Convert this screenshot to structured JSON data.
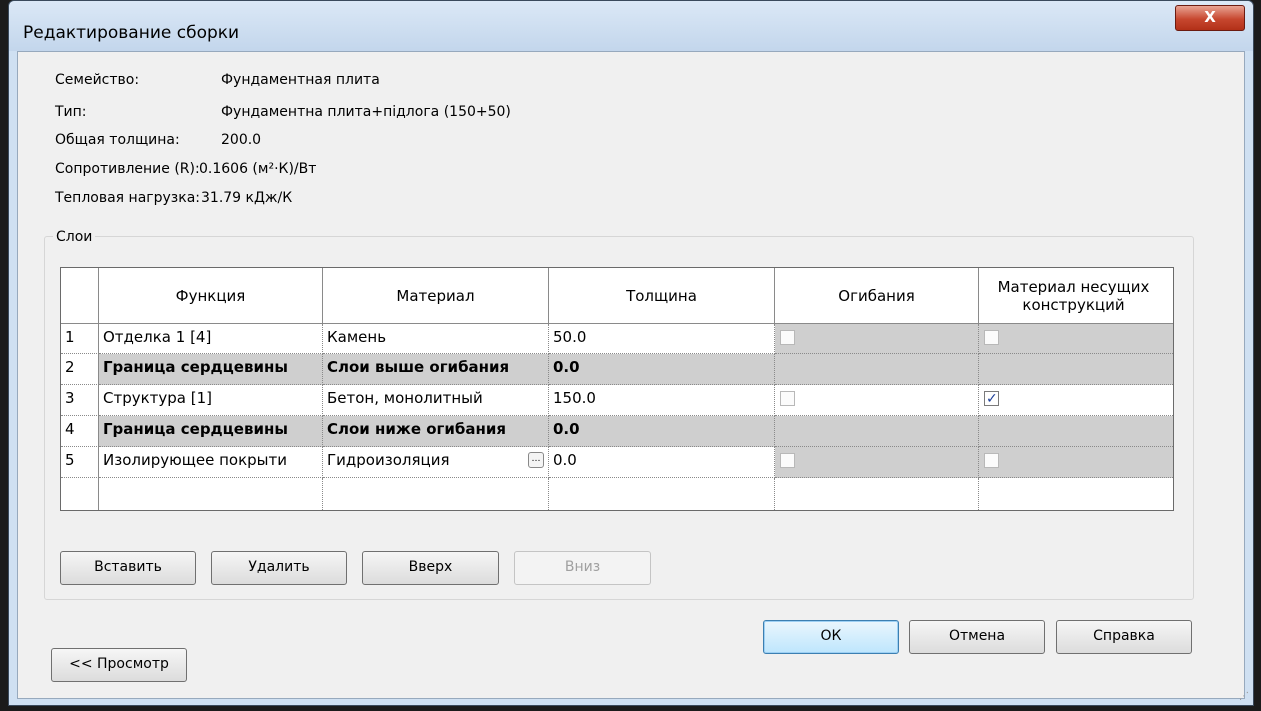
{
  "window": {
    "title": "Редактирование сборки",
    "close": "X"
  },
  "info": {
    "family_label": "Семейство:",
    "family_value": "Фундаментная плита",
    "type_label": "Тип:",
    "type_value": "Фундаментна плита+підлога (150+50)",
    "thickness_label": "Общая толщина:",
    "thickness_value": "200.0",
    "resistance_label": "Сопротивление (R):",
    "resistance_value": "0.1606 (м²·К)/Вт",
    "thermal_label": "Тепловая нагрузка:",
    "thermal_value": "31.79 кДж/К"
  },
  "layers": {
    "group_label": "Слои",
    "headers": [
      "",
      "Функция",
      "Материал",
      "Толщина",
      "Огибания",
      "Материал несущих конструкций"
    ],
    "rows": [
      {
        "num": "1",
        "function": "Отделка 1 [4]",
        "material": "Камень",
        "thickness": "50.0",
        "wraps": false,
        "structural": false,
        "core": false
      },
      {
        "num": "2",
        "function": "Граница сердцевины",
        "material": "Слои выше огибания",
        "thickness": "0.0",
        "core": true
      },
      {
        "num": "3",
        "function": "Структура [1]",
        "material": "Бетон, монолитный",
        "thickness": "150.0",
        "wraps": false,
        "structural": true,
        "core": false
      },
      {
        "num": "4",
        "function": "Граница сердцевины",
        "material": "Слои ниже огибания",
        "thickness": "0.0",
        "core": true
      },
      {
        "num": "5",
        "function": "Изолирующее покрыти",
        "material": "Гидроизоляция",
        "thickness": "0.0",
        "wraps": false,
        "structural": false,
        "core": false
      }
    ]
  },
  "buttons": {
    "insert": "Вставить",
    "delete": "Удалить",
    "up": "Вверх",
    "down": "Вниз",
    "ok": "ОК",
    "cancel": "Отмена",
    "help": "Справка",
    "preview": "<< Просмотр"
  },
  "colors": {
    "core_row": "#cfcfcf",
    "title_bar": "#c3d6ec",
    "close_button": "#c7472f"
  }
}
